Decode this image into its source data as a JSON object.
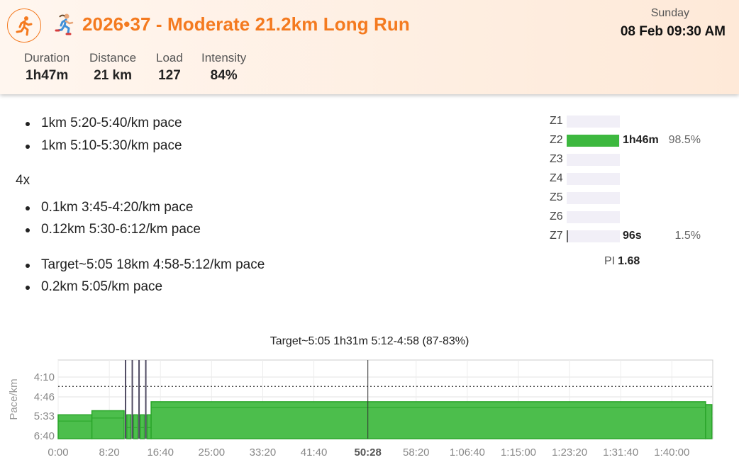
{
  "activity": {
    "title": "2026•37 - Moderate 21.2km Long Run",
    "day": "Sunday",
    "datetime": "08 Feb 09:30 AM",
    "icon": "running-person-icon",
    "accent_color": "#f47a1f"
  },
  "stats": [
    {
      "label": "Duration",
      "value": "1h47m"
    },
    {
      "label": "Distance",
      "value": "21 km"
    },
    {
      "label": "Load",
      "value": "127"
    },
    {
      "label": "Intensity",
      "value": "84%"
    }
  ],
  "workout": {
    "warmup": [
      "1km 5:20-5:40/km pace",
      "1km 5:10-5:30/km pace"
    ],
    "repeat_label": "4x",
    "repeat_steps": [
      "0.1km 3:45-4:20/km pace",
      "0.12km 5:30-6:12/km pace"
    ],
    "main": [
      "Target~5:05 18km 4:58-5:12/km pace",
      "0.2km 5:05/km pace"
    ]
  },
  "zones": [
    {
      "name": "Z1",
      "fraction": 0.0,
      "time": "",
      "pct": ""
    },
    {
      "name": "Z2",
      "fraction": 0.985,
      "time": "1h46m",
      "pct": "98.5%"
    },
    {
      "name": "Z3",
      "fraction": 0.0,
      "time": "",
      "pct": ""
    },
    {
      "name": "Z4",
      "fraction": 0.0,
      "time": "",
      "pct": ""
    },
    {
      "name": "Z5",
      "fraction": 0.0,
      "time": "",
      "pct": ""
    },
    {
      "name": "Z6",
      "fraction": 0.0,
      "time": "",
      "pct": ""
    },
    {
      "name": "Z7",
      "fraction": 0.015,
      "time": "96s",
      "pct": "1.5%"
    }
  ],
  "pi": {
    "label": "PI",
    "value": "1.68"
  },
  "zone_color": "#3db83f",
  "chart_data": {
    "type": "area",
    "title": "Target~5:05 1h31m 5:12-4:58 (87-83%)",
    "ylabel": "Pace/km",
    "y_ticks": [
      "4:10",
      "4:46",
      "5:33",
      "6:40"
    ],
    "x_ticks": [
      "0:00",
      "8:20",
      "16:40",
      "25:00",
      "33:20",
      "41:40",
      "50:28",
      "58:20",
      "1:06:40",
      "1:15:00",
      "1:23:20",
      "1:31:40",
      "1:40:00"
    ],
    "x_tick_seconds": [
      0,
      500,
      1000,
      1500,
      2000,
      2500,
      3028,
      3500,
      4000,
      4500,
      5000,
      5500,
      6000
    ],
    "highlight_tick": "50:28",
    "cursor_seconds": 3028,
    "x_range_seconds": [
      0,
      6400
    ],
    "target_line_pace": "4:27",
    "segments": [
      {
        "start_s": 0,
        "end_s": 330,
        "pace_top": "5:30",
        "pace_bottom": "5:50"
      },
      {
        "start_s": 330,
        "end_s": 645,
        "pace_top": "5:20",
        "pace_bottom": "5:40"
      },
      {
        "start_s": 645,
        "end_s": 671,
        "pace_top": "3:45",
        "pace_bottom": "4:20"
      },
      {
        "start_s": 671,
        "end_s": 711,
        "pace_top": "5:30",
        "pace_bottom": "6:12"
      },
      {
        "start_s": 711,
        "end_s": 737,
        "pace_top": "3:45",
        "pace_bottom": "4:20"
      },
      {
        "start_s": 737,
        "end_s": 777,
        "pace_top": "5:30",
        "pace_bottom": "6:12"
      },
      {
        "start_s": 777,
        "end_s": 803,
        "pace_top": "3:45",
        "pace_bottom": "4:20"
      },
      {
        "start_s": 803,
        "end_s": 843,
        "pace_top": "5:30",
        "pace_bottom": "6:12"
      },
      {
        "start_s": 843,
        "end_s": 869,
        "pace_top": "3:45",
        "pace_bottom": "4:20"
      },
      {
        "start_s": 869,
        "end_s": 909,
        "pace_top": "5:30",
        "pace_bottom": "6:12"
      },
      {
        "start_s": 909,
        "end_s": 6330,
        "pace_top": "4:58",
        "pace_bottom": "5:12"
      },
      {
        "start_s": 6330,
        "end_s": 6391,
        "pace_top": "5:05",
        "pace_bottom": "5:05"
      }
    ],
    "fill_color": "#4cbe4c",
    "stroke_color": "#2aa52a",
    "interval_color": "#514c63",
    "grid": true
  }
}
